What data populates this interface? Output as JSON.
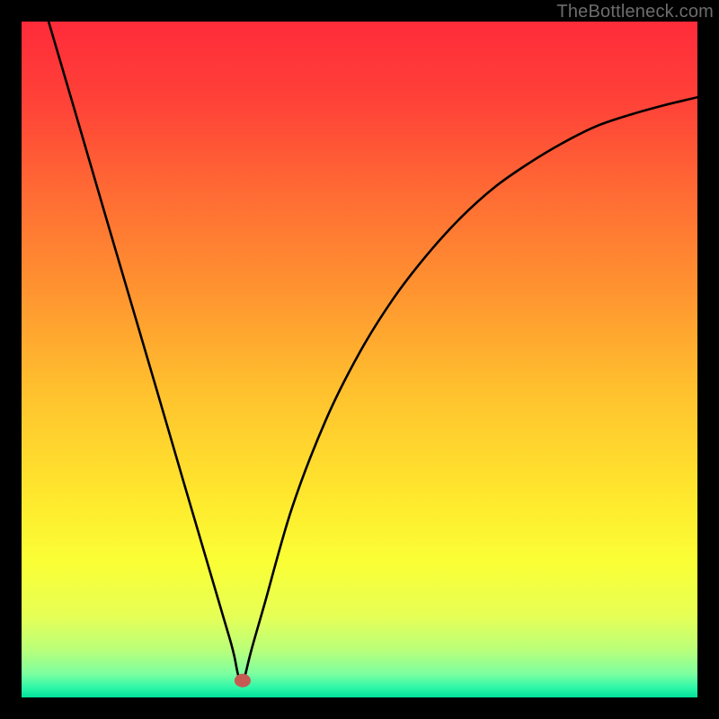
{
  "watermark": "TheBottleneck.com",
  "gradient": {
    "stops": [
      {
        "offset": 0.0,
        "color": "#ff2b3a"
      },
      {
        "offset": 0.12,
        "color": "#ff4238"
      },
      {
        "offset": 0.25,
        "color": "#ff6a34"
      },
      {
        "offset": 0.4,
        "color": "#ff9430"
      },
      {
        "offset": 0.55,
        "color": "#ffc22e"
      },
      {
        "offset": 0.7,
        "color": "#ffe72d"
      },
      {
        "offset": 0.8,
        "color": "#faff35"
      },
      {
        "offset": 0.88,
        "color": "#e6ff55"
      },
      {
        "offset": 0.93,
        "color": "#b9ff7a"
      },
      {
        "offset": 0.965,
        "color": "#7dffa0"
      },
      {
        "offset": 0.985,
        "color": "#30f7a8"
      },
      {
        "offset": 1.0,
        "color": "#00e19b"
      }
    ]
  },
  "marker": {
    "cx": 0.327,
    "cy": 0.975,
    "rx": 0.012,
    "ry": 0.01,
    "fill": "#c65a52"
  },
  "chart_data": {
    "type": "line",
    "title": "",
    "xlabel": "",
    "ylabel": "",
    "xlim": [
      0,
      1
    ],
    "ylim": [
      0,
      1
    ],
    "series": [
      {
        "name": "curve",
        "x": [
          0.04,
          0.08,
          0.12,
          0.16,
          0.2,
          0.24,
          0.28,
          0.3,
          0.31,
          0.315,
          0.32,
          0.325,
          0.33,
          0.34,
          0.36,
          0.4,
          0.45,
          0.5,
          0.55,
          0.6,
          0.65,
          0.7,
          0.75,
          0.8,
          0.85,
          0.9,
          0.95,
          1.0
        ],
        "y": [
          1.0,
          0.864,
          0.727,
          0.591,
          0.455,
          0.318,
          0.182,
          0.114,
          0.08,
          0.06,
          0.035,
          0.02,
          0.03,
          0.07,
          0.14,
          0.28,
          0.41,
          0.51,
          0.59,
          0.655,
          0.71,
          0.755,
          0.79,
          0.82,
          0.845,
          0.862,
          0.876,
          0.888
        ]
      }
    ],
    "marker_point": {
      "x": 0.327,
      "y": 0.025
    }
  }
}
